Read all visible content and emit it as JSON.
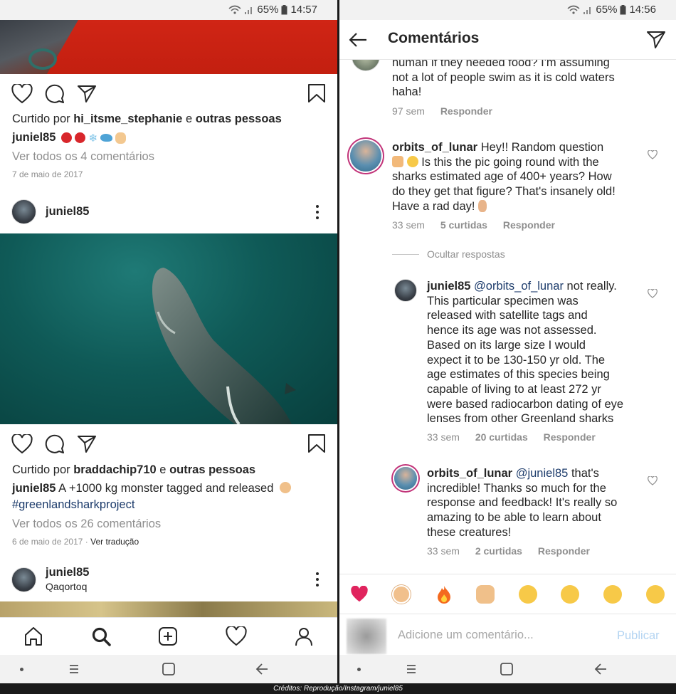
{
  "credit": "Créditos: Reprodução/Instagram/juniel85",
  "left": {
    "status": {
      "battery": "65%",
      "time": "14:57"
    },
    "post1": {
      "liked_prefix": "Curtido por",
      "liked_user": "hi_itsme_stephanie",
      "liked_and": "e",
      "liked_others": "outras pessoas",
      "caption_user": "juniel85",
      "view_comments": "Ver todos os 4 comentários",
      "date": "7 de maio de 2017"
    },
    "post2": {
      "username": "juniel85",
      "liked_prefix": "Curtido por",
      "liked_user": "braddachip710",
      "liked_and": "e",
      "liked_others": "outras pessoas",
      "caption_user": "juniel85",
      "caption_text": "A +1000 kg monster tagged and released",
      "hashtag": "#greenlandsharkproject",
      "view_comments": "Ver todos os 26 comentários",
      "date": "6 de maio de 2017",
      "translate": "Ver tradução"
    },
    "post3": {
      "username": "juniel85",
      "location": "Qaqortoq"
    }
  },
  "right": {
    "status": {
      "battery": "65%",
      "time": "14:56"
    },
    "title": "Comentários",
    "comments": [
      {
        "text_lines": [
          "human if they needed food? I'm assuming",
          "not a lot of people swim as it is cold waters",
          "haha!"
        ],
        "age": "97 sem",
        "reply": "Responder"
      },
      {
        "username": "orbits_of_lunar",
        "first_line": "Hey!! Random question",
        "text_lines": [
          "Is this the pic going round with the",
          "sharks estimated age of 400+ years? How",
          "do they get that figure? That's insanely old!",
          "Have a rad day!"
        ],
        "age": "33 sem",
        "likes": "5 curtidas",
        "reply": "Responder"
      },
      {
        "hide_replies": "Ocultar respostas"
      },
      {
        "username": "juniel85",
        "mention": "@orbits_of_lunar",
        "first_rest": "not really.",
        "text_lines": [
          "This particular specimen was",
          "released with satellite tags and",
          "hence its age was not assessed.",
          "Based on its large size I would",
          "expect it to be 130-150 yr old. The",
          "age estimates of this species being",
          "capable of living to at least 272 yr",
          "were based radiocarbon dating of eye",
          "lenses from other Greenland  sharks"
        ],
        "age": "33 sem",
        "likes": "20 curtidas",
        "reply": "Responder"
      },
      {
        "username": "orbits_of_lunar",
        "mention": "@juniel85",
        "first_rest": "that's",
        "text_lines": [
          "incredible! Thanks so much for the",
          "response and feedback! It's really so",
          "amazing to be able to learn about",
          "these creatures!"
        ],
        "age": "33 sem",
        "likes": "2 curtidas",
        "reply": "Responder"
      }
    ],
    "input_placeholder": "Adicione um comentário...",
    "publish": "Publicar"
  }
}
